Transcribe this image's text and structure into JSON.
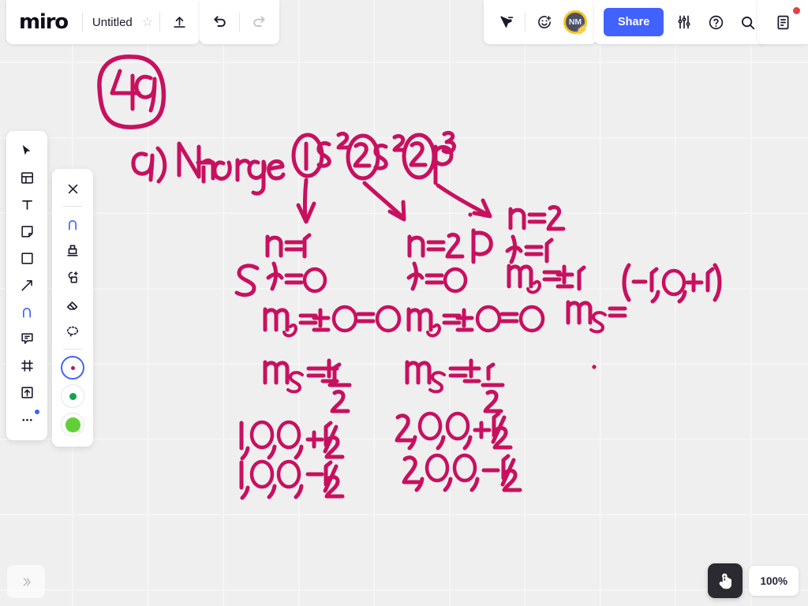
{
  "app": {
    "logo": "miro",
    "zoom_level": "100%"
  },
  "topbar": {
    "doc_name": "Untitled",
    "star_icon": "star-outline-icon",
    "upload_icon": "upload-icon",
    "undo_icon": "undo-icon",
    "redo_icon": "redo-icon",
    "cursor_share_icon": "cursor-pointer-share-icon",
    "emoji_icon": "add-reaction-icon",
    "avatar_initials": "NM",
    "avatar_badge_icon": "lightning-bolt-icon",
    "share_label": "Share",
    "settings_icon": "sliders-icon",
    "help_icon": "question-circle-icon",
    "search_icon": "search-icon",
    "notes_icon": "document-notes-icon",
    "notification_dot": "red-dot"
  },
  "left_toolbar": {
    "items": [
      {
        "name": "select-cursor",
        "icon": "cursor-arrow-icon"
      },
      {
        "name": "templates",
        "icon": "templates-grid-icon"
      },
      {
        "name": "text",
        "icon": "text-t-icon"
      },
      {
        "name": "sticky-note",
        "icon": "sticky-note-icon"
      },
      {
        "name": "shapes",
        "icon": "square-shape-icon"
      },
      {
        "name": "connector",
        "icon": "arrow-diagonal-icon"
      },
      {
        "name": "pen",
        "icon": "pen-marker-icon"
      },
      {
        "name": "comment",
        "icon": "comment-bubble-icon"
      },
      {
        "name": "frame",
        "icon": "frame-icon"
      },
      {
        "name": "upload",
        "icon": "upload-box-icon"
      },
      {
        "name": "more",
        "icon": "more-dots-icon"
      }
    ]
  },
  "pen_toolbar": {
    "close_icon": "close-x-icon",
    "items": [
      {
        "name": "pen",
        "icon": "pen-marker-icon"
      },
      {
        "name": "highlighter",
        "icon": "highlighter-icon"
      },
      {
        "name": "smart-drawing",
        "icon": "smart-shape-icon"
      },
      {
        "name": "eraser",
        "icon": "eraser-icon"
      },
      {
        "name": "lasso-select",
        "icon": "lasso-dashed-icon"
      }
    ],
    "swatches": [
      {
        "name": "stroke-size-small",
        "color": "#C8105F",
        "size": 5,
        "selected": true
      },
      {
        "name": "stroke-size-medium",
        "color": "#14a34a",
        "size": 9,
        "selected": false
      },
      {
        "name": "stroke-size-large",
        "color": "#5fd037",
        "size": 18,
        "selected": false
      }
    ]
  },
  "bottom": {
    "collapse_icon": "chevron-double-right-icon",
    "hand_tool_icon": "hand-touch-icon"
  },
  "colors": {
    "ink": "#C8105F",
    "accent": "#4262ff",
    "canvas_bg": "#efefef",
    "grid_line": "#f7f7f7",
    "avatar_ring": "#f5c518",
    "notification": "#e14343"
  },
  "canvas_notes": {
    "problem_number": "49",
    "part_label": "a) Nitrogen",
    "electron_config": "1s² 2s² 2p³",
    "orbital_circles": [
      "1s",
      "2s",
      "2p"
    ],
    "subshell_letters": [
      "S",
      "P"
    ],
    "column_1s": {
      "n": "n=1",
      "l": "l=0",
      "ml": "mℓ = ±0 = 0",
      "ms": "ms = ±1/2"
    },
    "column_2s": {
      "n": "n=2",
      "l": "l=0",
      "ml": "mℓ = ±0 = 0",
      "ms": "ms = ±1/2"
    },
    "column_2p": {
      "n": "n=2",
      "l": "l=1",
      "ml": "mℓ = ±1",
      "ml_values": "(-1, 0, +1)",
      "ms": "ms ="
    },
    "quantum_tuples_1s": [
      "1,0,0,+1/2",
      "1,0,0,-1/2"
    ],
    "quantum_tuples_2s": [
      "2,0,0,+1/2",
      "2,0,0,-1/2"
    ]
  }
}
